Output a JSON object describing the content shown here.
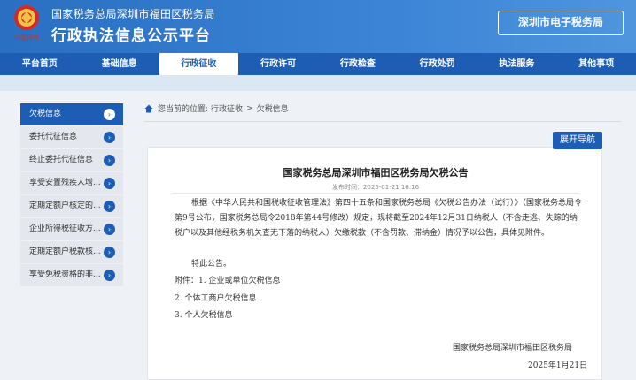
{
  "header": {
    "org": "国家税务总局深圳市福田区税务局",
    "platform": "行政执法信息公示平台",
    "e_bureau": "深圳市电子税务局",
    "logo_text": "中国税务"
  },
  "nav": [
    "平台首页",
    "基础信息",
    "行政征收",
    "行政许可",
    "行政检查",
    "行政处罚",
    "执法服务",
    "其他事项"
  ],
  "nav_active": "行政征收",
  "sidebar": [
    "欠税信息",
    "委托代征信息",
    "终止委托代征信息",
    "享受安置残疾人增...",
    "定期定额户核定的...",
    "企业所得税征收方...",
    "定期定额户税款核...",
    "享受免税资格的非..."
  ],
  "breadcrumb": {
    "prefix": "您当前的位置:",
    "level1": "行政征收",
    "sep": ">",
    "level2": "欠税信息"
  },
  "expand_nav": "展开导航",
  "article": {
    "title": "国家税务总局深圳市福田区税务局欠税公告",
    "published": "发布时间：2025-01-21 16:16",
    "body": "根据《中华人民共和国税收征收管理法》第四十五条和国家税务总局《欠税公告办法（试行）》（国家税务总局令第9号公布，国家税务总局令2018年第44号修改）规定，现将截至2024年12月31日纳税人（不含走逃、失踪的纳税户以及其他经税务机关查无下落的纳税人）欠缴税款（不含罚款、滞纳金）情况予以公告，具体见附件。",
    "notice": "特此公告。",
    "attachments": [
      "附件：1. 企业或单位欠税信息",
      "2. 个体工商户欠税信息",
      "3. 个人欠税信息"
    ],
    "signature": "国家税务总局深圳市福田区税务局",
    "date": "2025年1月21日"
  },
  "colors": {
    "primary": "#1d5db3",
    "header": "#3b84d6"
  }
}
